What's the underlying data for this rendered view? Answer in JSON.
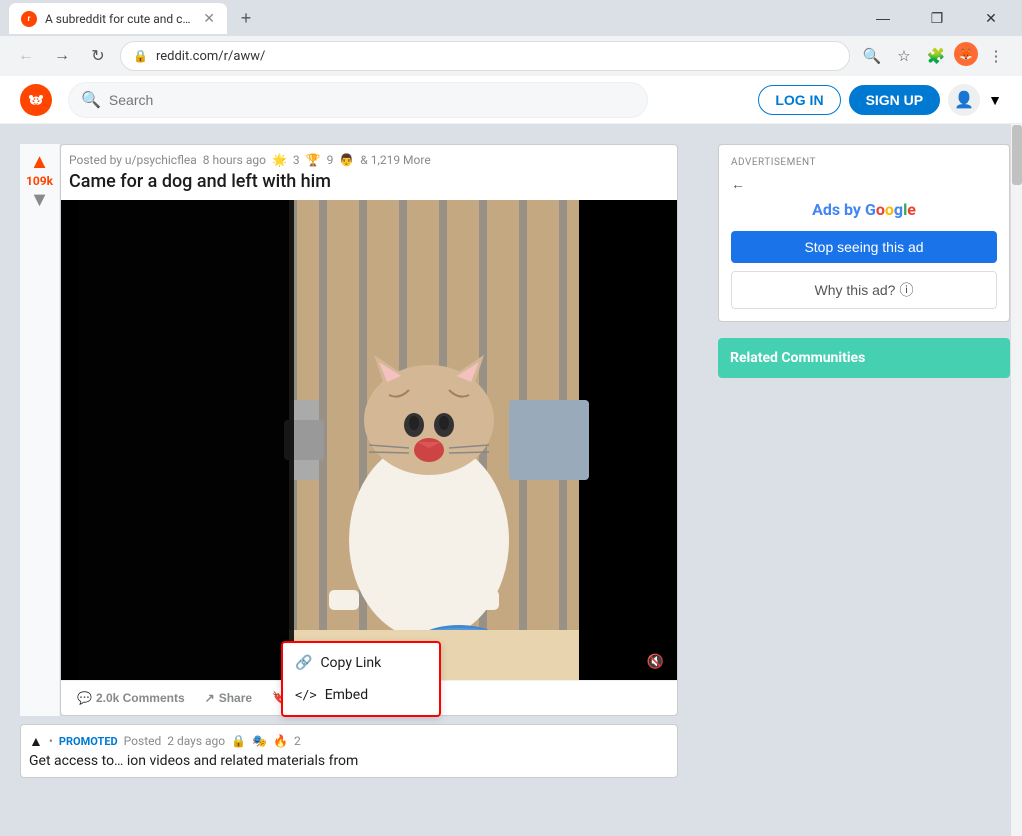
{
  "browser": {
    "tab_title": "A subreddit for cute and cuddly",
    "url": "reddit.com/r/aww/",
    "new_tab_label": "+",
    "back_disabled": false,
    "forward_disabled": false,
    "window_controls": {
      "minimize": "—",
      "maximize": "❐",
      "close": "✕"
    }
  },
  "header": {
    "search_placeholder": "Search",
    "login_label": "LOG IN",
    "signup_label": "SIGN UP"
  },
  "post": {
    "meta": {
      "posted_by": "Posted by u/psychicflea",
      "time_ago": "8 hours ago",
      "awards_count": "3",
      "awards2": "9",
      "more_label": "& 1,219 More"
    },
    "title": "Came for a dog and left with him",
    "vote_count": "109k",
    "comments_label": "2.0k Comments",
    "share_label": "Share",
    "save_label": "Save",
    "more_label": "•••",
    "volume_icon": "🔇"
  },
  "context_menu": {
    "copy_link_label": "Copy Link",
    "embed_label": "Embed",
    "link_icon": "🔗",
    "embed_icon": "<>"
  },
  "promoted_post": {
    "badge": "PROMOTED",
    "posted_prefix": "Posted",
    "time": "2 days ago",
    "awards": "2",
    "text": "Get access to… ion videos and related materials from"
  },
  "ad": {
    "advertisement_label": "ADVERTISEMENT",
    "back_icon": "←",
    "ads_by": "Ads by",
    "google_label": "Google",
    "stop_seeing_label": "Stop seeing this ad",
    "why_ad_label": "Why this ad?",
    "info_icon": "ⓘ"
  },
  "related_communities": {
    "title": "Related Communities"
  }
}
